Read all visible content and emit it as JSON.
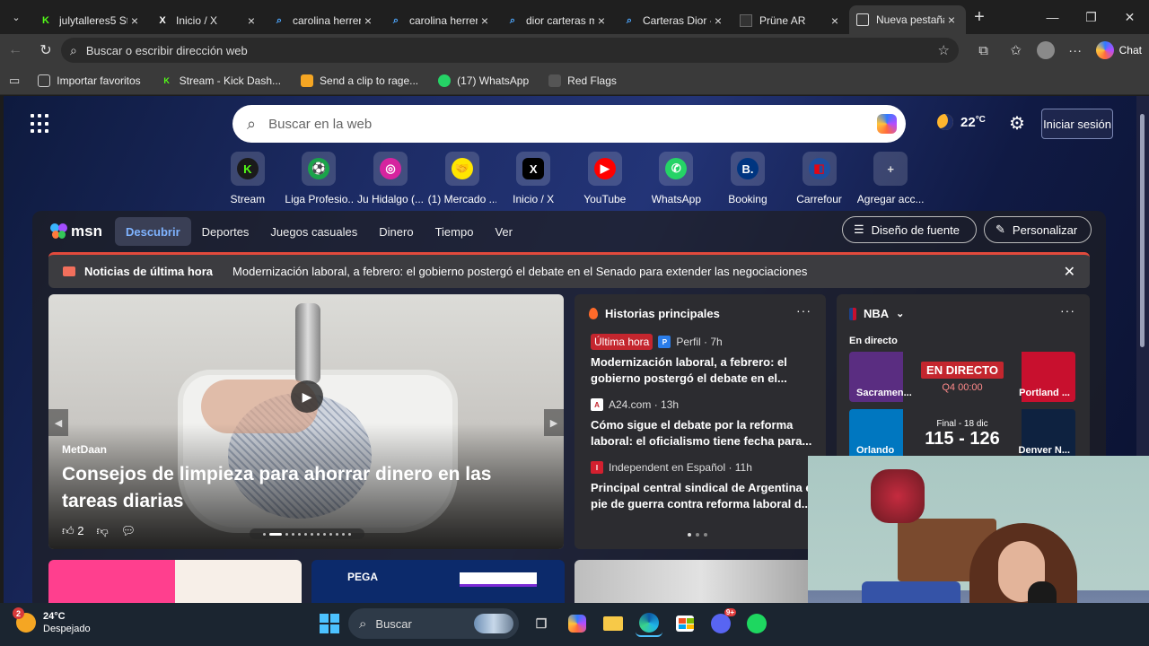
{
  "tabs": [
    {
      "title": "julytalleres5 Str",
      "favicon": "K",
      "color": "#53fc18",
      "active": false
    },
    {
      "title": "Inicio / X",
      "favicon": "X",
      "color": "#ffffff",
      "active": false
    },
    {
      "title": "carolina herrera",
      "favicon": "search-icon",
      "color": "#4ea8ff",
      "active": false
    },
    {
      "title": "carolina herrera",
      "favicon": "search-icon",
      "color": "#4ea8ff",
      "active": false
    },
    {
      "title": "dior carteras m",
      "favicon": "search-icon",
      "color": "#4ea8ff",
      "active": false
    },
    {
      "title": "Carteras Dior -",
      "favicon": "search-icon",
      "color": "#4ea8ff",
      "active": false
    },
    {
      "title": "Prüne AR",
      "favicon": "prune-icon",
      "color": "#333333",
      "active": false
    },
    {
      "title": "Nueva pestaña",
      "favicon": "newtab-icon",
      "color": "#dddddd",
      "active": true
    }
  ],
  "address": {
    "placeholder": "Buscar o escribir dirección web"
  },
  "chat_label": "Chat",
  "bookmarks": [
    {
      "label": "Importar favoritos",
      "icon": "import-icon",
      "color": "#cccccc"
    },
    {
      "label": "Stream - Kick Dash...",
      "icon": "K",
      "color": "#53fc18"
    },
    {
      "label": "Send a clip to rage...",
      "icon": "rage-icon",
      "color": "#f5a623"
    },
    {
      "label": "(17) WhatsApp",
      "icon": "whatsapp-icon",
      "color": "#25d366"
    },
    {
      "label": "Red Flags",
      "icon": "flag-icon",
      "color": "#555555"
    }
  ],
  "newtab": {
    "search_placeholder": "Buscar en la web",
    "weather": {
      "temp": "22",
      "unit": "°C"
    },
    "signin": "Iniciar sesión",
    "quick_links": [
      {
        "label": "Stream",
        "glyph": "K",
        "bg": "#1a1a1a",
        "fg": "#53fc18"
      },
      {
        "label": "Liga Profesio...",
        "glyph": "⚽",
        "bg": "#1aa34a",
        "fg": "#ffffff"
      },
      {
        "label": "Ju Hidalgo (...",
        "glyph": "◎",
        "bg": "#d6249f",
        "fg": "#ffffff"
      },
      {
        "label": "(1) Mercado ...",
        "glyph": "🤝",
        "bg": "#ffe600",
        "fg": "#2d3277"
      },
      {
        "label": "Inicio / X",
        "glyph": "X",
        "bg": "#000000",
        "fg": "#ffffff"
      },
      {
        "label": "YouTube",
        "glyph": "▶",
        "bg": "#ff0000",
        "fg": "#ffffff"
      },
      {
        "label": "WhatsApp",
        "glyph": "✆",
        "bg": "#25d366",
        "fg": "#ffffff"
      },
      {
        "label": "Booking",
        "glyph": "B.",
        "bg": "#003580",
        "fg": "#ffffff"
      },
      {
        "label": "Carrefour",
        "glyph": "◧",
        "bg": "#1e4fa0",
        "fg": "#e30613"
      },
      {
        "label": "Agregar acc...",
        "glyph": "+",
        "bg": "transparent",
        "fg": "#dddddd"
      }
    ]
  },
  "msn": {
    "logo": "msn",
    "nav": [
      "Descubrir",
      "Deportes",
      "Juegos casuales",
      "Dinero",
      "Tiempo",
      "Ver"
    ],
    "font_design": "Diseño de fuente",
    "personalize": "Personalizar",
    "breaking_label": "Noticias de última hora",
    "breaking_text": "Modernización laboral, a febrero: el gobierno postergó el debate en el Senado para extender las negociaciones",
    "hero": {
      "source": "MetDaan",
      "title": "Consejos de limpieza para ahorrar dinero en las tareas diarias",
      "likes": "2",
      "slides": 13,
      "active_slide": 1
    },
    "top_stories": {
      "heading": "Historias principales",
      "items": [
        {
          "badge": "Última hora",
          "source": "Perfil · 7h",
          "icon_color": "#2b7de9",
          "icon": "P",
          "headline": "Modernización laboral, a febrero: el\ngobierno postergó el debate en el..."
        },
        {
          "badge": "",
          "source": "A24.com · 13h",
          "icon_color": "#ffffff",
          "icon": "A",
          "headline": "Cómo sigue el debate por la reforma\nlaboral: el oficialismo tiene fecha para..."
        },
        {
          "badge": "",
          "source": "Independent en Español · 11h",
          "icon_color": "#d3202f",
          "icon": "I",
          "headline": "Principal central sindical de Argentina en\npie de guerra contra reforma laboral d..."
        }
      ],
      "pages": 3,
      "active_page": 0
    },
    "nba": {
      "title": "NBA",
      "live_label": "En directo",
      "games": [
        {
          "left": "Sacramen...",
          "right": "Portland ...",
          "status": "EN DIRECTO",
          "detail": "Q4 00:00",
          "left_color": "#5a2d81",
          "right_color": "#c8102e"
        },
        {
          "left": "Orlando",
          "right": "Denver N...",
          "status": "Final - 18 dic",
          "detail": "115 - 126",
          "left_color": "#0077c0",
          "right_color": "#0e2240"
        }
      ]
    }
  },
  "taskbar": {
    "weather_temp": "24°C",
    "weather_desc": "Despejado",
    "weather_badge": "2",
    "search_label": "Buscar",
    "discord_badge": "9+"
  }
}
